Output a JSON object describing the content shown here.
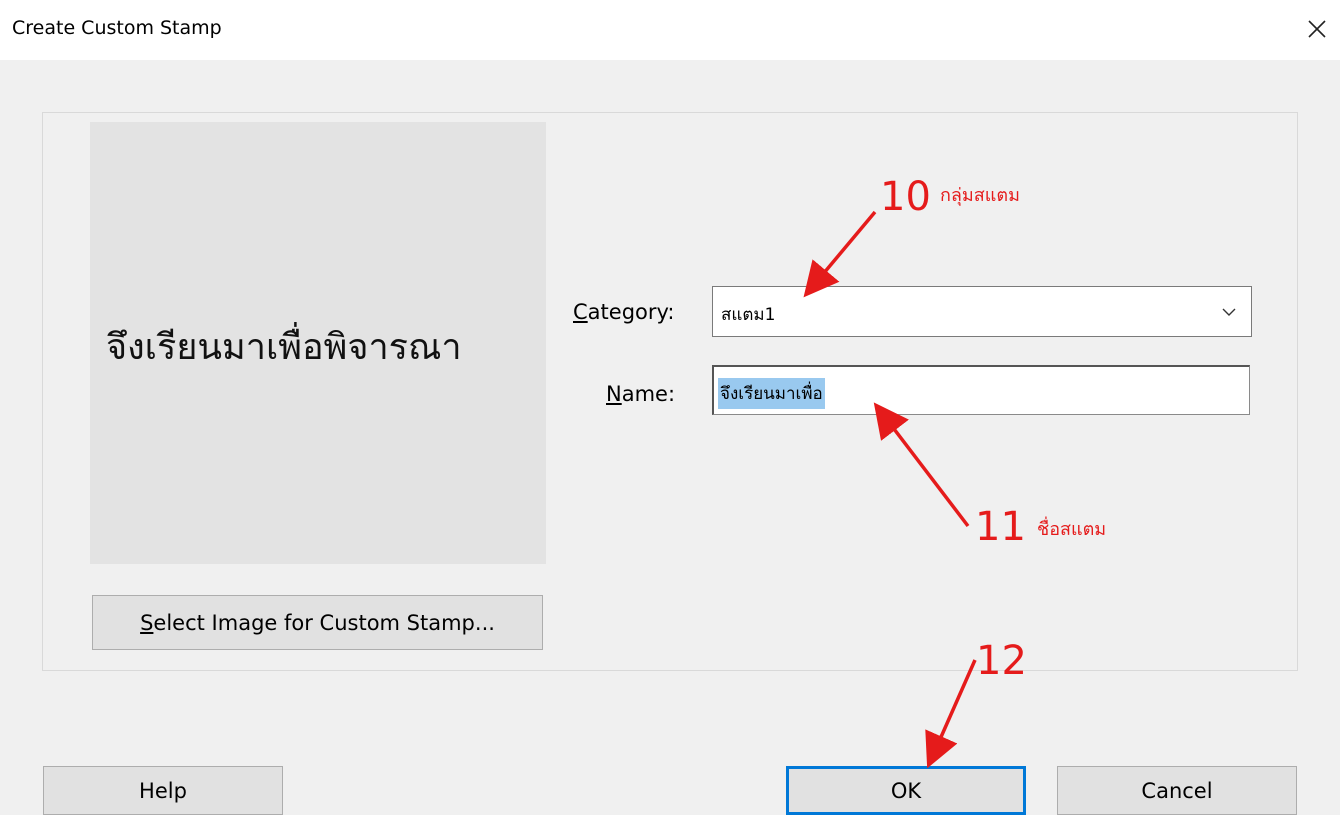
{
  "window": {
    "title": "Create Custom Stamp",
    "close_icon": "close-icon"
  },
  "preview": {
    "stamp_text": "จึงเรียนมาเพื่อพิจารณา"
  },
  "buttons": {
    "select_image": "Select Image for Custom Stamp...",
    "help": "Help",
    "ok": "OK",
    "cancel": "Cancel"
  },
  "form": {
    "category_label": "Category:",
    "category_value": "สแตม1",
    "name_label": "Name:",
    "name_value": "จึงเรียนมาเพื่อ"
  },
  "annotations": [
    {
      "number": "10",
      "text": "กลุ่มสแตม"
    },
    {
      "number": "11",
      "text": "ชื่อสแตม"
    },
    {
      "number": "12",
      "text": ""
    }
  ],
  "colors": {
    "annotation": "#e51b1b",
    "focus_border": "#0078d7",
    "selection": "#99c9ef"
  }
}
